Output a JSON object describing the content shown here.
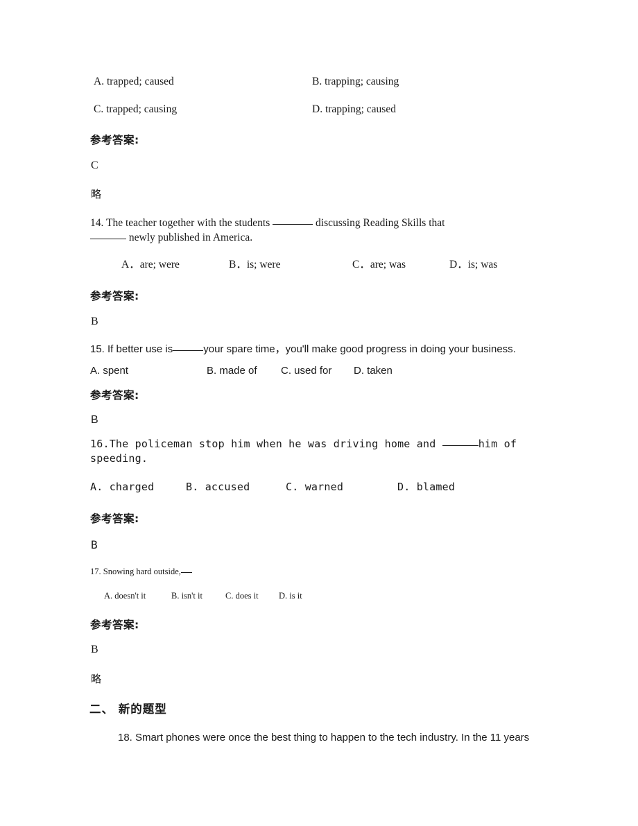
{
  "document": {
    "background": "#ffffff",
    "text_color": "#1a1a1a"
  },
  "labels": {
    "reference_answer": "参考答案:",
    "omitted": "略"
  },
  "questions": [
    {
      "id": "q13-options",
      "number": "",
      "options": [
        {
          "key": "A.",
          "text": "A. trapped; caused"
        },
        {
          "key": "B.",
          "text": "B. trapping; causing"
        },
        {
          "key": "C.",
          "text": "C. trapped; causing"
        },
        {
          "key": "D.",
          "text": "D. trapping; caused"
        }
      ],
      "answer": "C",
      "omitted": "略"
    },
    {
      "number": "14.",
      "stem_line1_a": "14. The teacher together with the students",
      "stem_line1_b": "discussing Reading Skills that",
      "stem_line2": "newly published in America.",
      "options": [
        {
          "text": "A．are; were"
        },
        {
          "text": "B．is; were"
        },
        {
          "text": "C．are; was"
        },
        {
          "text": "D．is; was"
        }
      ],
      "answer": "B"
    },
    {
      "number": "15.",
      "stem_a": "15. If better use is",
      "stem_b": "your spare time，you'll make good progress in doing your business.",
      "options": [
        {
          "text": "A. spent"
        },
        {
          "text": "B. made of"
        },
        {
          "text": "C. used for"
        },
        {
          "text": "D. taken"
        }
      ],
      "answer": "B"
    },
    {
      "number": "16.",
      "stem_line1_a": "16.The policeman stop him when he was driving home and",
      "stem_line1_b": "him of",
      "stem_line2": "speeding.",
      "options": [
        {
          "text": "A. charged"
        },
        {
          "text": "B. accused"
        },
        {
          "text": "C. warned"
        },
        {
          "text": "D. blamed"
        }
      ],
      "answer": "B"
    },
    {
      "number": "17.",
      "stem": "17. Snowing hard outside,",
      "options": [
        {
          "text": "A. doesn't it"
        },
        {
          "text": "B. isn't it"
        },
        {
          "text": "C. does it"
        },
        {
          "text": "D. is it"
        }
      ],
      "answer": "B",
      "omitted": "略"
    }
  ],
  "section": {
    "heading": "二、 新的题型",
    "first_question": "18. Smart phones were once the best thing to happen to the tech industry. In the 11 years"
  }
}
